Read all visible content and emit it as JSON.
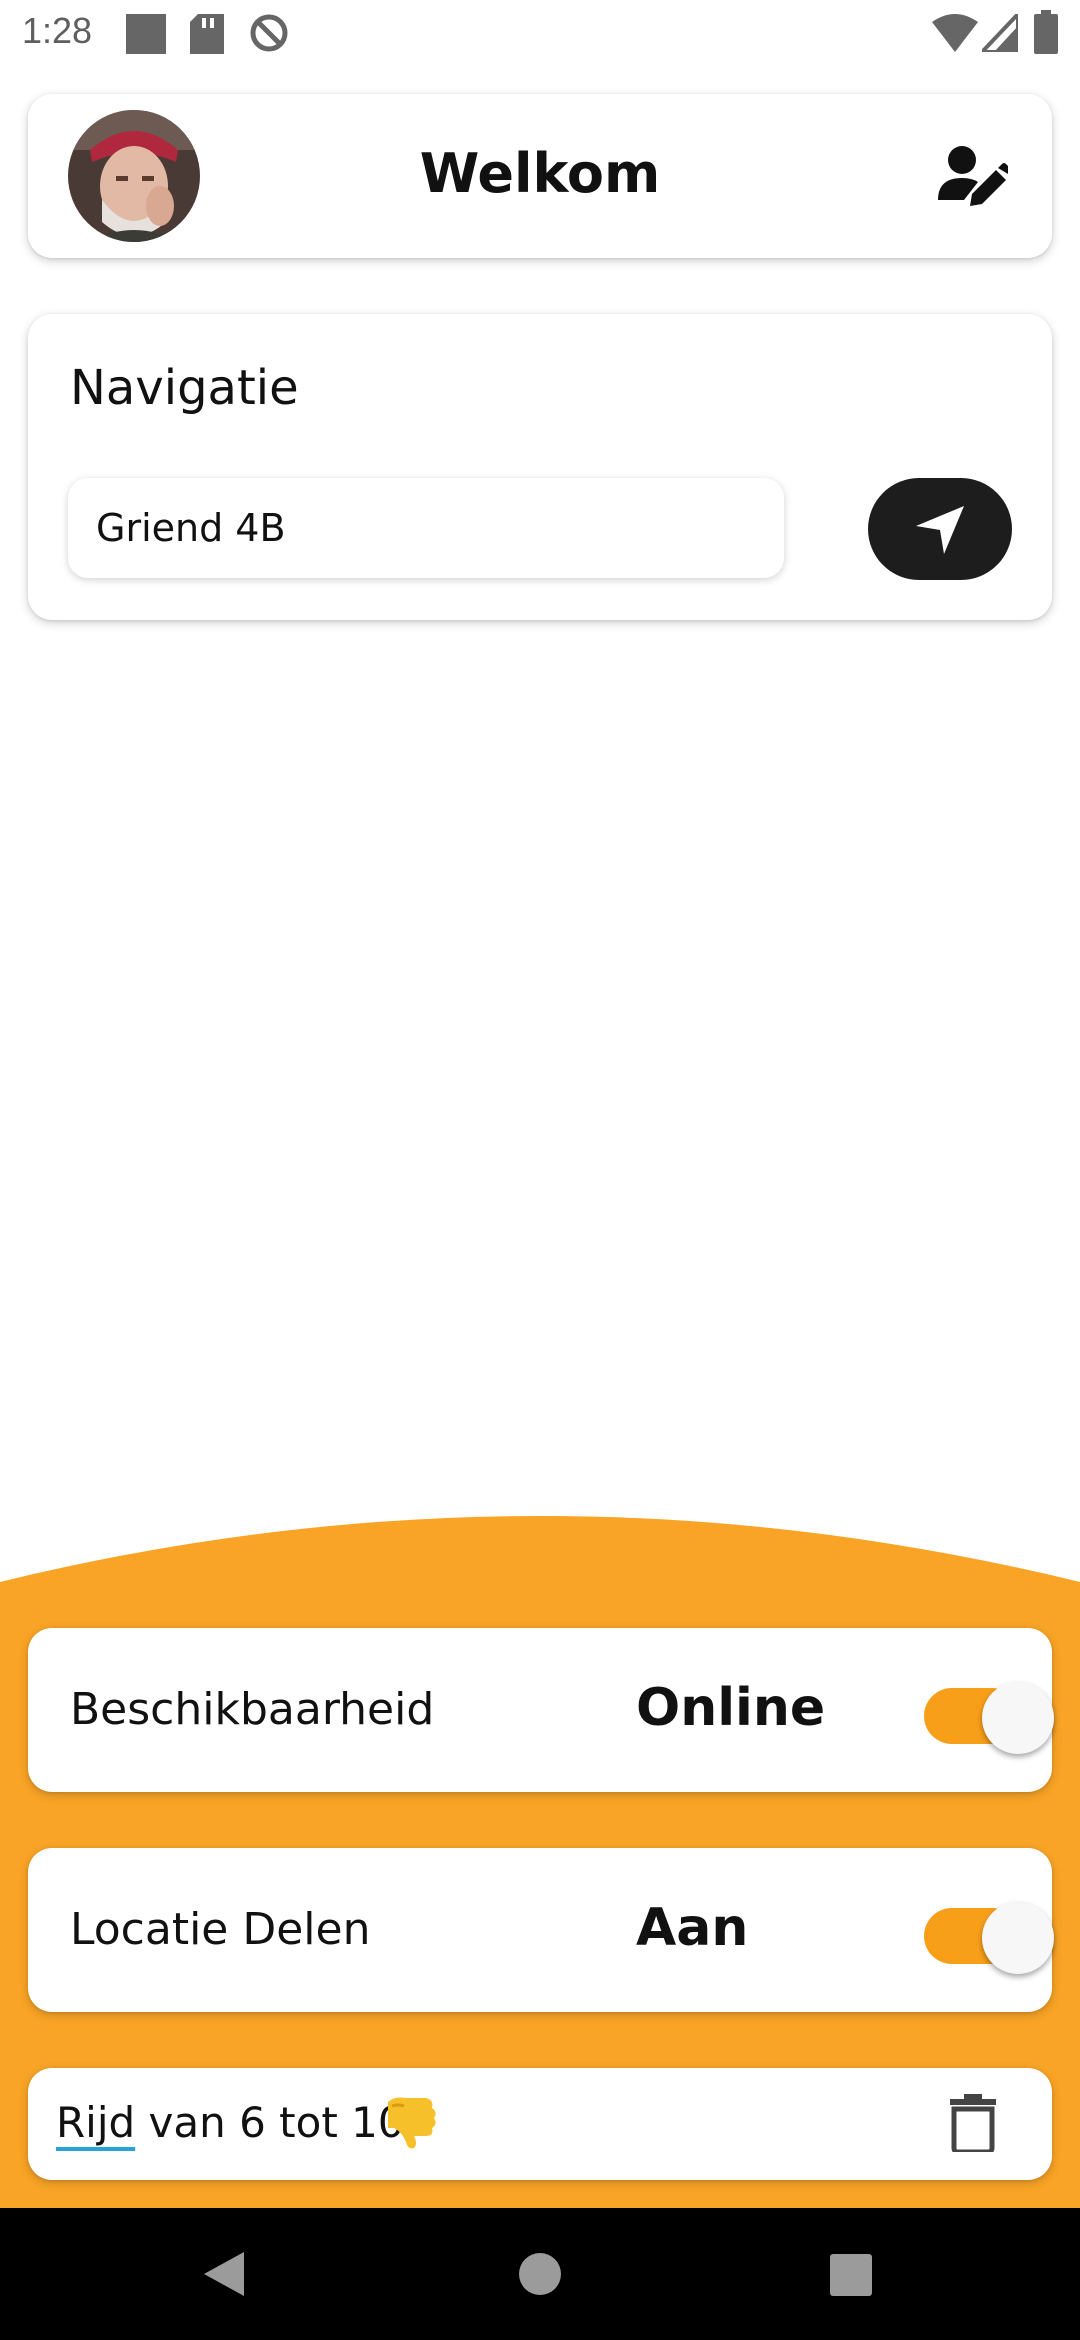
{
  "status_bar": {
    "time": "1:28",
    "left_icons": [
      "square-icon",
      "sd-card-icon",
      "no-sync-icon"
    ],
    "right_icons": [
      "wifi-icon",
      "signal-icon",
      "battery-icon"
    ]
  },
  "header": {
    "title": "Welkom",
    "avatar": "profile-avatar",
    "edit_icon": "edit-profile-icon"
  },
  "navigation": {
    "title": "Navigatie",
    "destination_value": "Griend 4B",
    "go_icon": "navigation-arrow-icon"
  },
  "availability": {
    "label": "Beschikbaarheid",
    "value": "Online",
    "enabled": true
  },
  "location_sharing": {
    "label": "Locatie Delen",
    "value": "Aan",
    "enabled": true
  },
  "note": {
    "first_word": "Rijd",
    "rest": " van 6 tot 10",
    "emoji_icon": "thumbs-down-icon",
    "delete_icon": "trash-icon"
  },
  "colors": {
    "accent": "#f9a426",
    "switch_track": "#f89f1a",
    "nav_button": "#1d1d1d"
  },
  "system_nav": [
    "back-icon",
    "home-icon",
    "recents-icon"
  ]
}
